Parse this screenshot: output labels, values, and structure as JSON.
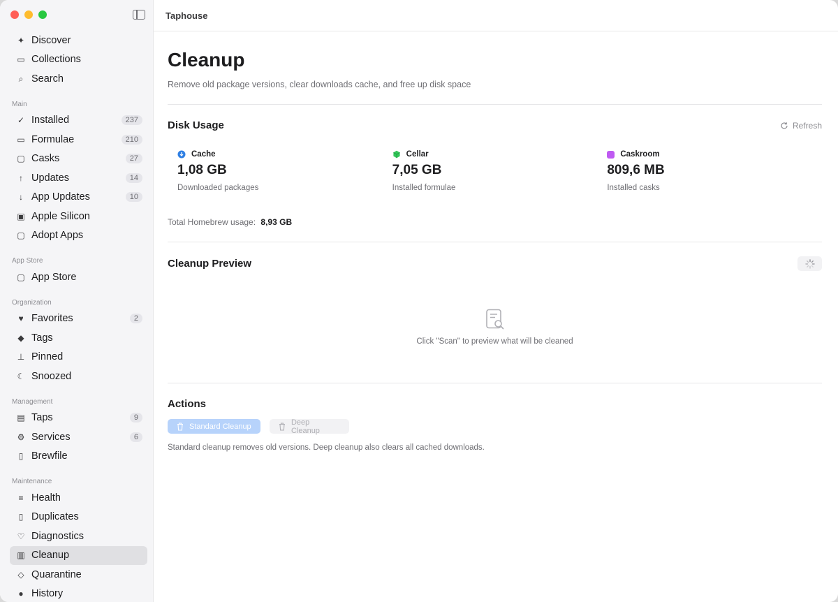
{
  "app": {
    "title": "Taphouse"
  },
  "sidebar": {
    "top_items": [
      {
        "label": "Discover",
        "icon": "sparkle-icon"
      },
      {
        "label": "Collections",
        "icon": "collections-icon"
      },
      {
        "label": "Search",
        "icon": "search-icon"
      }
    ],
    "sections": [
      {
        "label": "Main",
        "items": [
          {
            "label": "Installed",
            "icon": "checkmark-circle-icon",
            "badge": "237"
          },
          {
            "label": "Formulae",
            "icon": "terminal-icon",
            "badge": "210"
          },
          {
            "label": "Casks",
            "icon": "cask-icon",
            "badge": "27"
          },
          {
            "label": "Updates",
            "icon": "arrow-up-circle-icon",
            "badge": "14"
          },
          {
            "label": "App Updates",
            "icon": "app-update-icon",
            "badge": "10"
          },
          {
            "label": "Apple Silicon",
            "icon": "chip-icon"
          },
          {
            "label": "Adopt Apps",
            "icon": "adopt-icon"
          }
        ]
      },
      {
        "label": "App Store",
        "items": [
          {
            "label": "App Store",
            "icon": "bag-icon"
          }
        ]
      },
      {
        "label": "Organization",
        "items": [
          {
            "label": "Favorites",
            "icon": "heart-icon",
            "badge": "2"
          },
          {
            "label": "Tags",
            "icon": "tag-icon"
          },
          {
            "label": "Pinned",
            "icon": "pin-icon"
          },
          {
            "label": "Snoozed",
            "icon": "moon-icon"
          }
        ]
      },
      {
        "label": "Management",
        "items": [
          {
            "label": "Taps",
            "icon": "taps-icon",
            "badge": "9"
          },
          {
            "label": "Services",
            "icon": "gears-icon",
            "badge": "6"
          },
          {
            "label": "Brewfile",
            "icon": "document-icon"
          }
        ]
      },
      {
        "label": "Maintenance",
        "items": [
          {
            "label": "Health",
            "icon": "list-icon"
          },
          {
            "label": "Duplicates",
            "icon": "duplicate-icon"
          },
          {
            "label": "Diagnostics",
            "icon": "stethoscope-icon"
          },
          {
            "label": "Cleanup",
            "icon": "trash-icon",
            "active": true
          },
          {
            "label": "Quarantine",
            "icon": "shield-icon"
          },
          {
            "label": "History",
            "icon": "clock-icon"
          }
        ]
      }
    ]
  },
  "page": {
    "title": "Cleanup",
    "subtitle": "Remove old package versions, clear downloads cache, and free up disk space"
  },
  "disk_usage": {
    "title": "Disk Usage",
    "refresh_label": "Refresh",
    "stats": [
      {
        "name": "Cache",
        "value": "1,08 GB",
        "sub": "Downloaded packages",
        "color": "#2f7fe3"
      },
      {
        "name": "Cellar",
        "value": "7,05 GB",
        "sub": "Installed formulae",
        "color": "#34c759"
      },
      {
        "name": "Caskroom",
        "value": "809,6 MB",
        "sub": "Installed casks",
        "color": "#bf5af2"
      }
    ],
    "total_label": "Total Homebrew usage:",
    "total_value": "8,93 GB"
  },
  "preview": {
    "title": "Cleanup Preview",
    "empty_text": "Click \"Scan\" to preview what will be cleaned"
  },
  "actions": {
    "title": "Actions",
    "standard_label": "Standard Cleanup",
    "deep_label": "Deep Cleanup",
    "note": "Standard cleanup removes old versions. Deep cleanup also clears all cached downloads."
  }
}
